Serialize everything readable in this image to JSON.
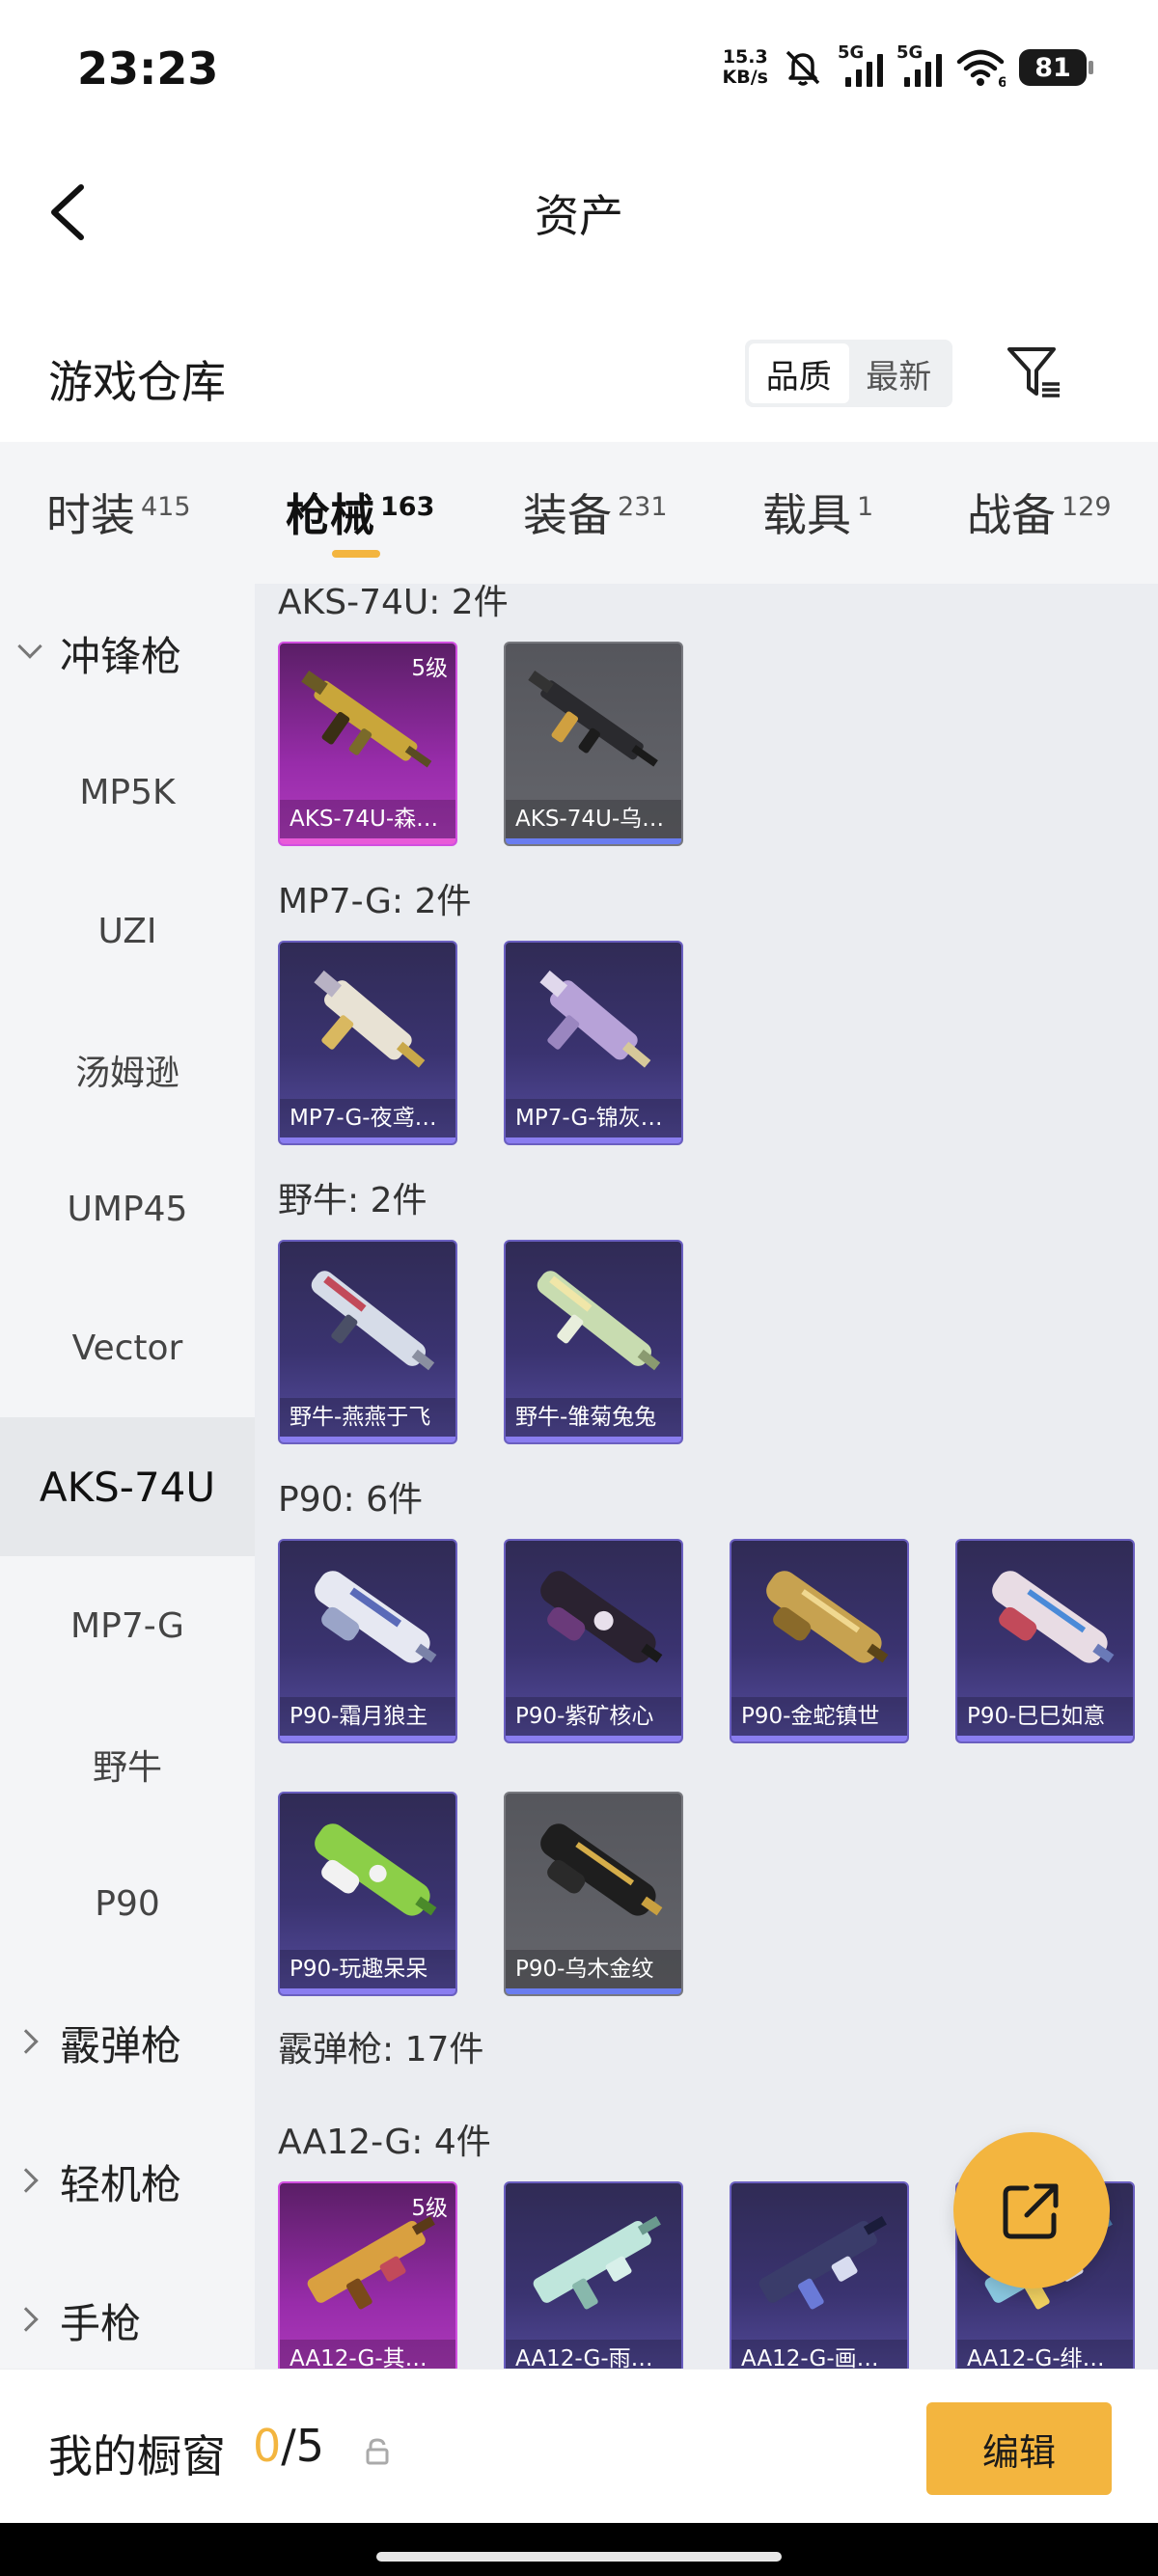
{
  "status": {
    "time": "23:23",
    "speed_value": "15.3",
    "speed_unit": "KB/s",
    "sig1": "5G",
    "sig2": "5G",
    "wifi_sub": "6",
    "battery": "81"
  },
  "header": {
    "title": "资产"
  },
  "warehouse": {
    "title": "游戏仓库",
    "sort_quality": "品质",
    "sort_newest": "最新"
  },
  "tabs": [
    {
      "label": "时装",
      "count": "415"
    },
    {
      "label": "枪械",
      "count": "163"
    },
    {
      "label": "装备",
      "count": "231"
    },
    {
      "label": "载具",
      "count": "1"
    },
    {
      "label": "战备",
      "count": "129"
    }
  ],
  "sidebar": {
    "groups": [
      {
        "label": "冲锋枪",
        "expanded": true
      },
      {
        "label": "霰弹枪",
        "expanded": false
      },
      {
        "label": "轻机枪",
        "expanded": false
      },
      {
        "label": "手枪",
        "expanded": false
      }
    ],
    "items": [
      "MP5K",
      "UZI",
      "汤姆逊",
      "UMP45",
      "Vector",
      "AKS-74U",
      "MP7-G",
      "野牛",
      "P90"
    ],
    "active": "AKS-74U"
  },
  "content": {
    "sections": [
      {
        "label": "AKS-74U: 2件",
        "cards": [
          {
            "name": "AKS-74U-森…",
            "level": "5级",
            "rarity": "pink"
          },
          {
            "name": "AKS-74U-乌…",
            "rarity": "gray"
          }
        ]
      },
      {
        "label": "MP7-G: 2件",
        "cards": [
          {
            "name": "MP7-G-夜鸢…",
            "rarity": "purple"
          },
          {
            "name": "MP7-G-锦灰…",
            "rarity": "purple"
          }
        ]
      },
      {
        "label": "野牛: 2件",
        "cards": [
          {
            "name": "野牛-燕燕于飞",
            "rarity": "purple"
          },
          {
            "name": "野牛-雏菊兔兔",
            "rarity": "purple"
          }
        ]
      },
      {
        "label": "P90: 6件",
        "cards": [
          {
            "name": "P90-霜月狼主",
            "rarity": "purple"
          },
          {
            "name": "P90-紫矿核心",
            "rarity": "purple"
          },
          {
            "name": "P90-金蛇镇世",
            "rarity": "purple"
          },
          {
            "name": "P90-巳巳如意",
            "rarity": "purple"
          },
          {
            "name": "P90-玩趣呆呆",
            "rarity": "purple"
          },
          {
            "name": "P90-乌木金纹",
            "rarity": "gray"
          }
        ]
      },
      {
        "label": "霰弹枪: 17件",
        "cards": []
      },
      {
        "label": "AA12-G: 4件",
        "cards": [
          {
            "name": "AA12-G-其…",
            "level": "5级",
            "rarity": "pink"
          },
          {
            "name": "AA12-G-雨…",
            "rarity": "purple"
          },
          {
            "name": "AA12-G-画…",
            "rarity": "purple"
          },
          {
            "name": "AA12-G-绯…",
            "rarity": "purple"
          }
        ]
      }
    ]
  },
  "showcase": {
    "label": "我的橱窗",
    "current": "0",
    "separator": "/",
    "max": "5",
    "edit_label": "编辑"
  },
  "colors": {
    "accent": "#f3b53f",
    "epic": "#6a5fc0",
    "legendary": "#d14fe0",
    "common": "#77787e"
  },
  "icons": [
    "back-arrow-icon",
    "filter-icon",
    "chevron-down-icon",
    "chevron-right-icon",
    "share-icon",
    "lock-icon"
  ]
}
